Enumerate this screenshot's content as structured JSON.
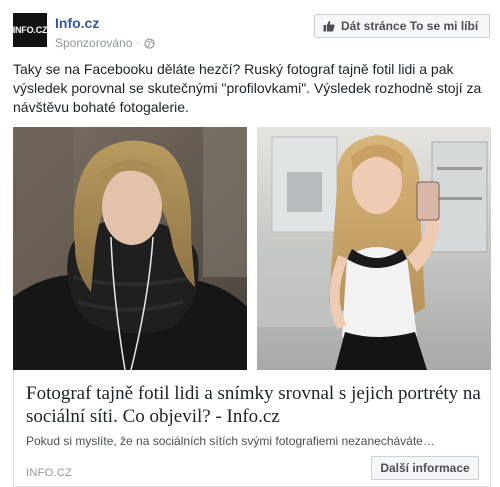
{
  "header": {
    "avatar_logo": "INFO.CZ",
    "page_name": "Info.cz",
    "sponsored": "Sponzorováno",
    "separator": "·",
    "icon": "globe-icon"
  },
  "like_button": {
    "icon": "thumb-up-icon",
    "label": "Dát stránce To se mi líbí"
  },
  "post": {
    "text": "Taky se na Facebooku děláte hezčí? Ruský fotograf tajně fotil lidi a pak výsledek porovnal se skutečnými \"profilovkami\". Výsledek rozhodně stojí za návštěvu bohaté fotogalerie."
  },
  "link_preview": {
    "headline": "Fotograf tajně fotil lidi a snímky srovnal s jejich portréty na sociální síti. Co objevil? - Info.cz",
    "description": "Pokud si myslíte, že na sociálních sítích svými fotografiemi nezanecháváte…",
    "domain": "INFO.CZ",
    "button_label": "Další informace"
  },
  "colors": {
    "page_name": "#365899",
    "secondary_text": "#90949c",
    "button_bg": "#f6f7f9",
    "button_border": "#ced0d4"
  }
}
